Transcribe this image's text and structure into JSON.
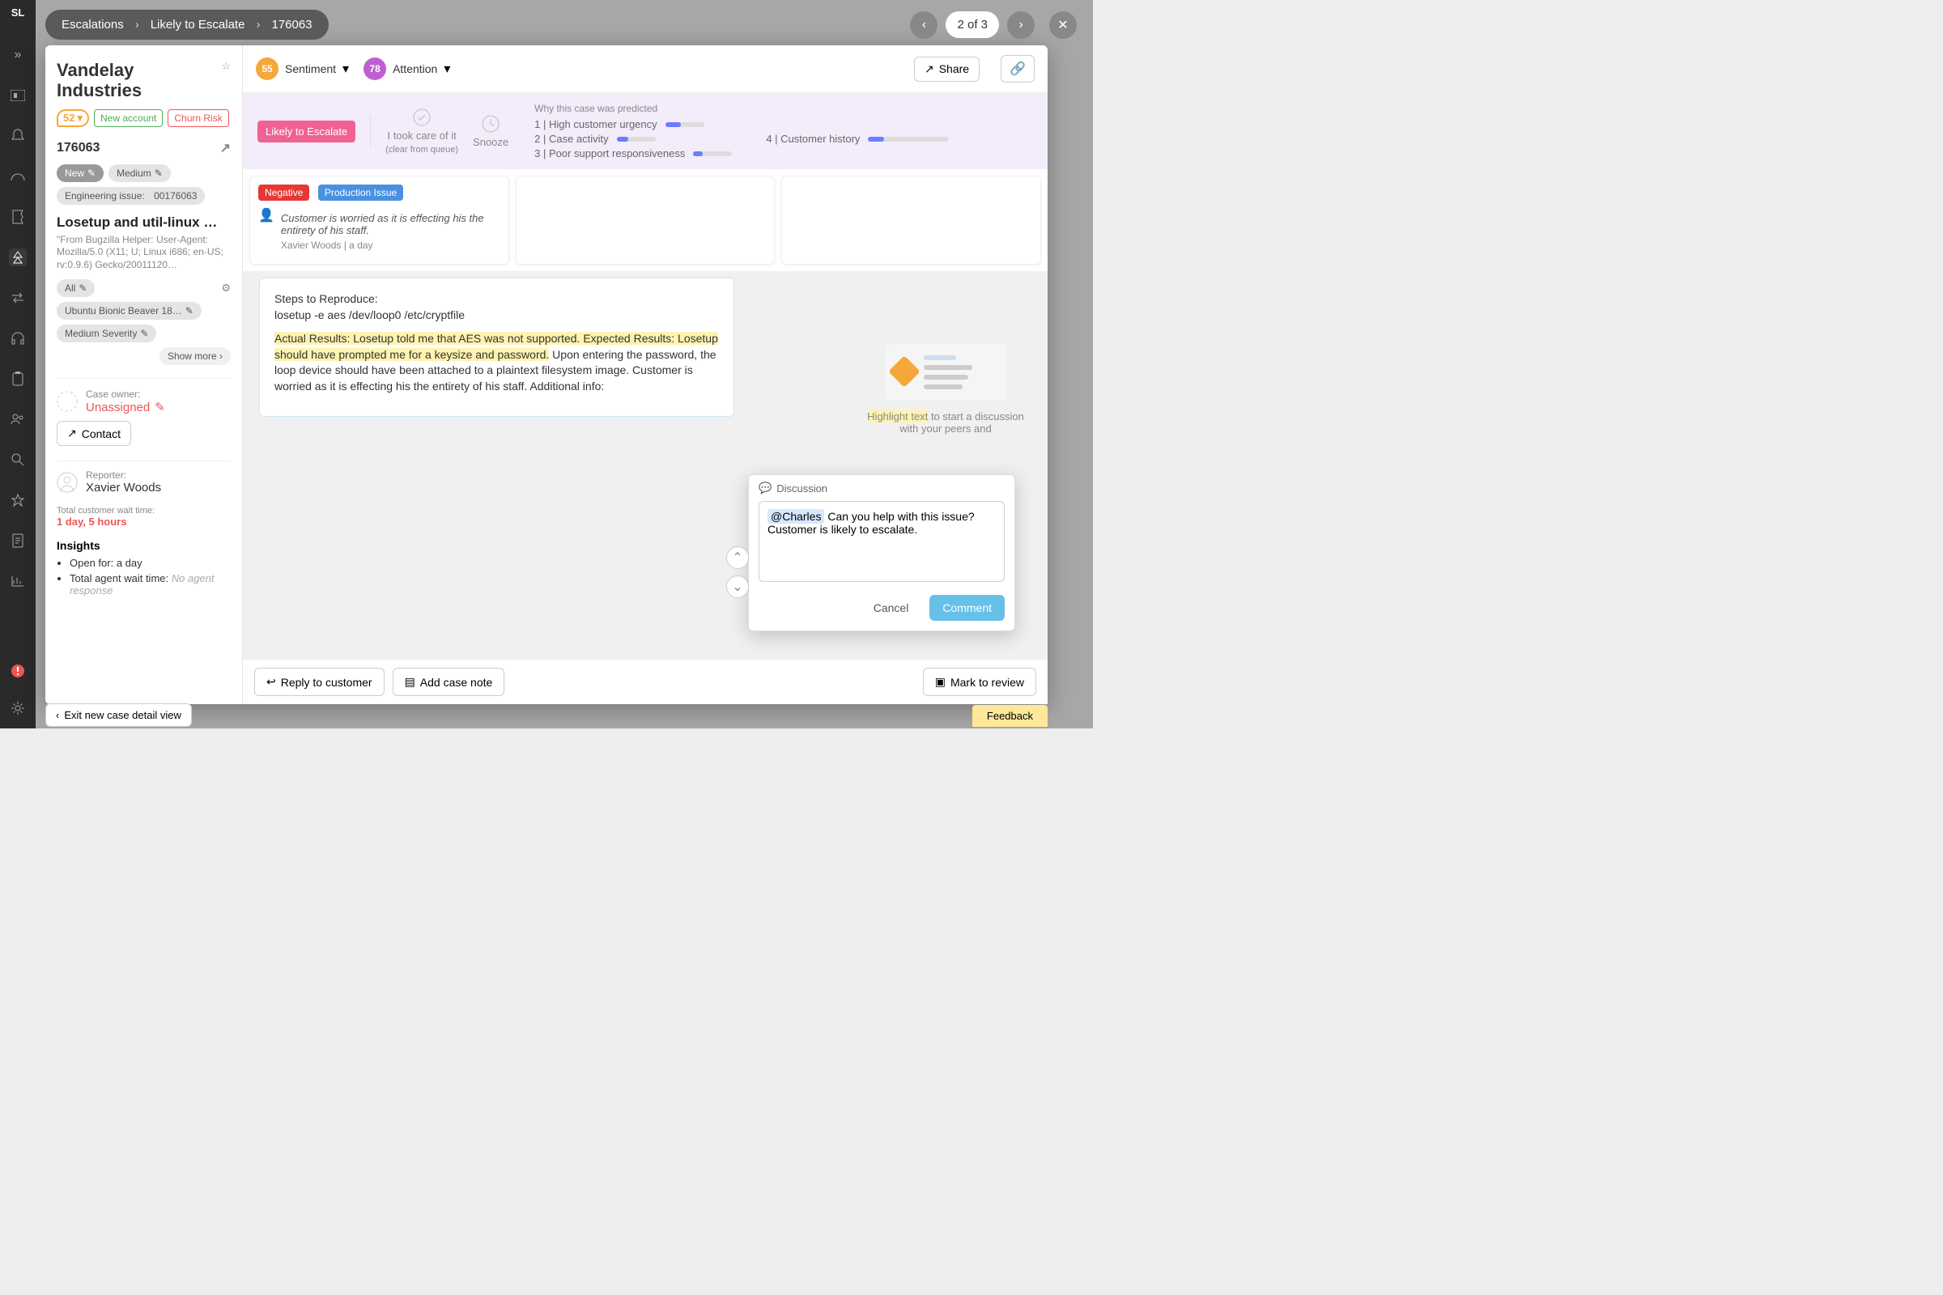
{
  "breadcrumb": {
    "a": "Escalations",
    "b": "Likely to Escalate",
    "c": "176063"
  },
  "pager": {
    "label": "2 of 3"
  },
  "rail": [
    "dashboard",
    "bell",
    "gauge",
    "ticket",
    "escalate",
    "swap",
    "headset",
    "clipboard",
    "people",
    "search",
    "star",
    "doc",
    "chart",
    "alert",
    "gear"
  ],
  "account": {
    "name": "Vandelay Industries",
    "score": "52",
    "badges": {
      "newaccount": "New account",
      "churn": "Churn Risk"
    },
    "caseId": "176063",
    "status": "New",
    "priority": "Medium",
    "eng": {
      "label": "Engineering issue:",
      "value": "00176063"
    },
    "title": "Losetup and util-linux …",
    "desc": "\"From Bugzilla Helper: User-Agent: Mozilla/5.0 (X11; U; Linux i686; en-US; rv:0.9.6) Gecko/20011120…",
    "chip_all": "All",
    "chip_os": "Ubuntu Bionic Beaver 18…",
    "chip_sev": "Medium Severity",
    "showmore": "Show more",
    "owner": {
      "label": "Case owner:",
      "value": "Unassigned"
    },
    "contact": "Contact",
    "reporter": {
      "label": "Reporter:",
      "value": "Xavier Woods"
    },
    "wait": {
      "label": "Total customer wait time:",
      "value": "1 day, 5 hours"
    },
    "insights": {
      "header": "Insights",
      "open": {
        "label": "Open for:",
        "value": "a day"
      },
      "agent": {
        "label": "Total agent wait time:",
        "value": "No agent response"
      }
    }
  },
  "scores": {
    "sentiment": {
      "value": "55",
      "label": "Sentiment"
    },
    "attention": {
      "value": "78",
      "label": "Attention"
    }
  },
  "share": "Share",
  "band": {
    "lte": "Likely to Escalate",
    "took": "I took care of it",
    "tookSub": "(clear from queue)",
    "snooze": "Snooze",
    "why": "Why this case was predicted",
    "r1": "1 | High customer urgency",
    "r2": "2 | Case activity",
    "r3": "3 | Poor support responsiveness",
    "r4": "4 | Customer history"
  },
  "ct": {
    "neg": "Negative",
    "prod": "Production Issue",
    "quote": "Customer is worried as it is effecting his the entirety of his staff.",
    "meta": "Xavier Woods | a day"
  },
  "msg": {
    "l1": "Steps to Reproduce:",
    "l2": "losetup -e aes /dev/loop0 /etc/cryptfile",
    "hl1": "Actual Results: Losetup told me that AES was not supported. Expected Results: Losetup should have prompted me for a keysize and password.",
    "l3": " Upon entering the password, the loop device should have been attached to a plaintext filesystem image. Customer is worried as it is effecting his the entirety of his staff. Additional info:"
  },
  "hint": {
    "hl": "Highlight text",
    "rest": " to start a discussion with your peers and"
  },
  "disc": {
    "header": "Discussion",
    "mention": "@Charles",
    "text": " Can you help with this issue? Customer is likely to escalate.",
    "cancel": "Cancel",
    "comment": "Comment"
  },
  "bottom": {
    "reply": "Reply to customer",
    "note": "Add case note",
    "mark": "Mark to review"
  },
  "exit": "Exit new case detail view",
  "feedback": "Feedback"
}
